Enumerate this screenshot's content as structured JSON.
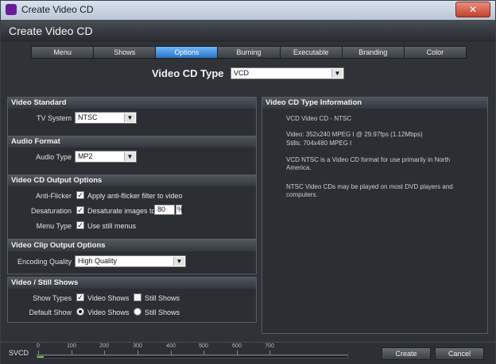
{
  "window": {
    "title": "Create Video CD",
    "header_title": "Create Video CD"
  },
  "tabs": [
    {
      "label": "Menu"
    },
    {
      "label": "Shows"
    },
    {
      "label": "Options"
    },
    {
      "label": "Burning"
    },
    {
      "label": "Executable"
    },
    {
      "label": "Branding"
    },
    {
      "label": "Color"
    }
  ],
  "video_cd_type": {
    "label": "Video CD Type",
    "value": "VCD"
  },
  "video_standard": {
    "title": "Video Standard",
    "tv_system_label": "TV System",
    "tv_system_value": "NTSC"
  },
  "audio_format": {
    "title": "Audio Format",
    "audio_type_label": "Audio Type",
    "audio_type_value": "MP2"
  },
  "output_options": {
    "title": "Video CD Output Options",
    "anti_flicker_label": "Anti-Flicker",
    "anti_flicker_text": "Apply anti-flicker filter to video",
    "desaturation_label": "Desaturation",
    "desaturation_text": "Desaturate images to",
    "desaturation_value": "80",
    "desaturation_unit": "%",
    "menu_type_label": "Menu Type",
    "menu_type_text": "Use still menus"
  },
  "clip_options": {
    "title": "Video Clip Output Options",
    "encoding_label": "Encoding Quality",
    "encoding_value": "High Quality"
  },
  "shows": {
    "title": "Video / Still Shows",
    "show_types_label": "Show Types",
    "video_shows_text": "Video Shows",
    "still_shows_text": "Still Shows",
    "default_show_label": "Default Show",
    "default_video_text": "Video Shows",
    "default_still_text": "Still Shows"
  },
  "info": {
    "title": "Video CD Type Information",
    "line1": "VCD Video CD - NTSC",
    "line2": "Video: 352x240 MPEG I @ 29.97fps (1.12Mbps)",
    "line3": "Stills: 704x480 MPEG I",
    "line4": "VCD NTSC is a Video CD format for use primarily in North America.",
    "line5": "NTSC Video CDs may be played on most DVD players and computers."
  },
  "bottom": {
    "svcd_label": "SVCD",
    "scale": [
      "0",
      "100",
      "200",
      "300",
      "400",
      "500",
      "600",
      "700"
    ],
    "usage_value": 0.02,
    "create_label": "Create",
    "cancel_label": "Cancel"
  }
}
